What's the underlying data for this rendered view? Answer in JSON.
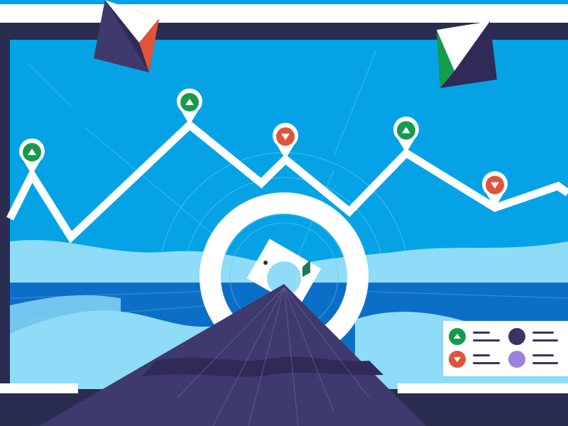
{
  "colors": {
    "sky": "#05a3e6",
    "sky_light": "#8fdcf8",
    "sea": "#0c6fc7",
    "frame": "#2a2d50",
    "white": "#ffffff",
    "mountain": "#3f3a6e",
    "mountain_dark": "#2f2a57",
    "up": "#169b4d",
    "down": "#e0543b",
    "legend_dark": "#3b3360",
    "legend_light": "#9b82dc"
  },
  "chart": {
    "trend": [
      {
        "index": 0,
        "level": 0.38,
        "direction": "up"
      },
      {
        "index": 1,
        "level": 0.7,
        "direction": "up"
      },
      {
        "index": 2,
        "level": 0.48,
        "direction": "down"
      },
      {
        "index": 3,
        "level": 0.52,
        "direction": "up"
      },
      {
        "index": 4,
        "level": 0.17,
        "direction": "down"
      }
    ]
  },
  "legend": {
    "items": [
      {
        "icon": "triangle-up-icon",
        "color": "#169b4d",
        "dot_color": "#3b3360"
      },
      {
        "icon": "triangle-down-icon",
        "color": "#e0543b",
        "dot_color": "#9b82dc"
      }
    ]
  },
  "icons": [
    "map-pin-up-icon",
    "map-pin-down-icon",
    "compass-ring-icon",
    "mountain-icon",
    "pyramid-icon"
  ]
}
